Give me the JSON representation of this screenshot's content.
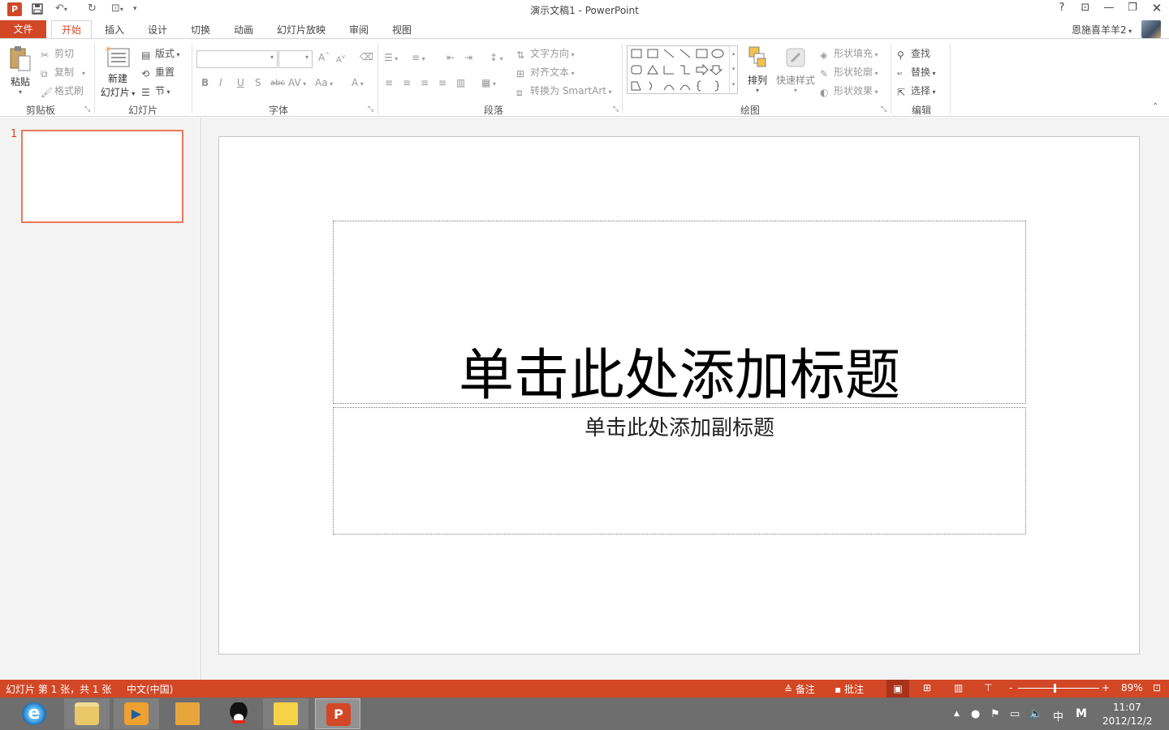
{
  "window": {
    "title": "演示文稿1 - PowerPoint",
    "help": "?",
    "user": "恩施喜羊羊2"
  },
  "tabs": [
    "文件",
    "开始",
    "插入",
    "设计",
    "切换",
    "动画",
    "幻灯片放映",
    "审阅",
    "视图"
  ],
  "ribbon": {
    "clipboard": {
      "paste": "粘贴",
      "cut": "剪切",
      "copy": "复制",
      "format_painter": "格式刷",
      "label": "剪贴板"
    },
    "slides": {
      "new_slide_line1": "新建",
      "new_slide_line2": "幻灯片",
      "layout": "版式",
      "reset": "重置",
      "section": "节",
      "label": "幻灯片"
    },
    "font": {
      "bold": "B",
      "italic": "I",
      "underline": "U",
      "shadow": "S",
      "strike": "abc",
      "spacing": "AV",
      "case": "Aa",
      "grow": "A",
      "shrink": "A",
      "color": "A",
      "label": "字体"
    },
    "paragraph": {
      "text_direction": "文字方向",
      "align_text": "对齐文本",
      "convert_smartart": "转换为 SmartArt",
      "label": "段落"
    },
    "drawing": {
      "arrange": "排列",
      "quick_styles": "快速样式",
      "shape_fill": "形状填充",
      "shape_outline": "形状轮廓",
      "shape_effects": "形状效果",
      "label": "绘图"
    },
    "editing": {
      "find": "查找",
      "replace": "替换",
      "select": "选择",
      "label": "编辑"
    }
  },
  "thumbnails": [
    {
      "number": "1"
    }
  ],
  "slide": {
    "title_placeholder": "单击此处添加标题",
    "subtitle_placeholder": "单击此处添加副标题"
  },
  "statusbar": {
    "slide_info": "幻灯片 第 1 张，共 1 张",
    "language": "中文(中国)",
    "notes": "备注",
    "comments": "批注",
    "zoom_minus": "-",
    "zoom_plus": "+",
    "zoom": "89%",
    "zoom_level": 0.45
  },
  "taskbar": {
    "ime": "中",
    "ime2": "M",
    "time": "11:07",
    "date": "2012/12/2"
  },
  "colors": {
    "accent": "#d24726",
    "accent_light": "#e8795b",
    "taskbar": "#6e6e6e"
  }
}
